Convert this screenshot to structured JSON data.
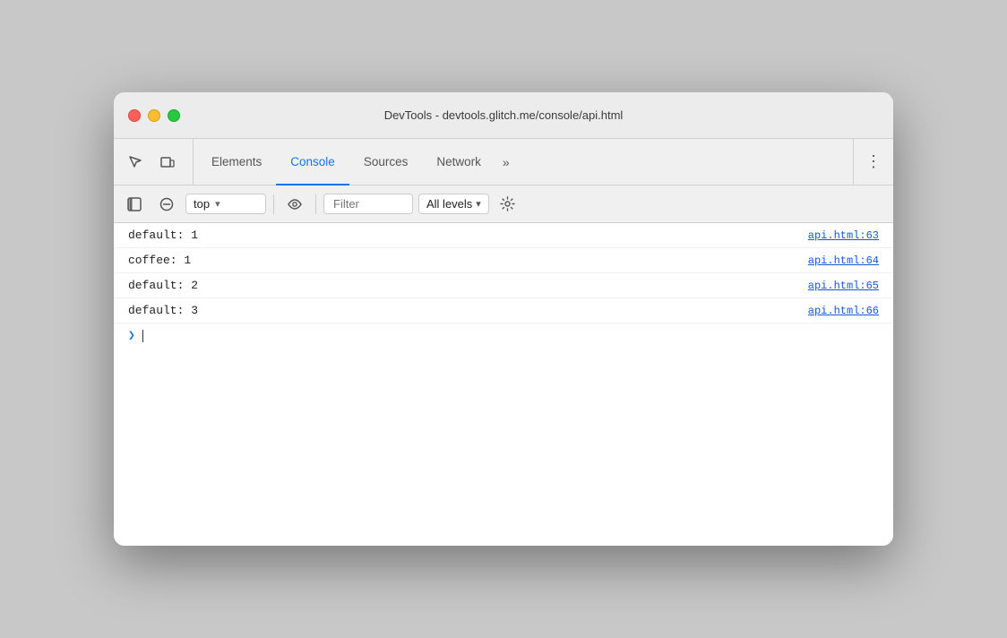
{
  "window": {
    "title": "DevTools - devtools.glitch.me/console/api.html"
  },
  "toolbar": {
    "tabs": [
      {
        "id": "elements",
        "label": "Elements",
        "active": false
      },
      {
        "id": "console",
        "label": "Console",
        "active": true
      },
      {
        "id": "sources",
        "label": "Sources",
        "active": false
      },
      {
        "id": "network",
        "label": "Network",
        "active": false
      }
    ],
    "overflow_label": "»",
    "kebab_label": "⋮"
  },
  "console_bar": {
    "context": "top",
    "context_arrow": "▾",
    "filter_placeholder": "Filter",
    "level": "All levels",
    "level_arrow": "▾"
  },
  "log_entries": [
    {
      "text": "default: 1",
      "source": "api.html:63"
    },
    {
      "text": "coffee: 1",
      "source": "api.html:64"
    },
    {
      "text": "default: 2",
      "source": "api.html:65"
    },
    {
      "text": "default: 3",
      "source": "api.html:66"
    }
  ]
}
